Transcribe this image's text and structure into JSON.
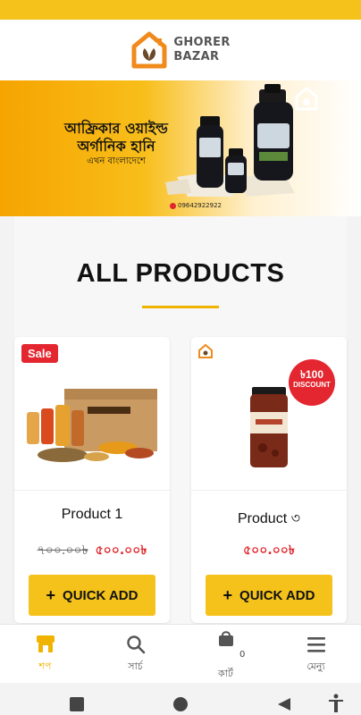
{
  "brand": {
    "line1": "GHORER",
    "line2": "BAZAR"
  },
  "banner": {
    "line1": "আফ্রিকার ওয়াইল্ড",
    "line2": "অর্গানিক হানি",
    "line3": "এখন বাংলাদেশে",
    "phone": "09642922922",
    "jar_label": "HONEY"
  },
  "section": {
    "title": "ALL PRODUCTS"
  },
  "products": [
    {
      "name": "Product 1",
      "old_price": "৭০০.০০৳",
      "price": "৫০০.০০৳",
      "badge": "Sale",
      "button": "QUICK ADD"
    },
    {
      "name": "Product ৩",
      "old_price": "",
      "price": "৫০০.০০৳",
      "badge": "৳100 DISCOUNT",
      "badge_line1": "৳100",
      "badge_line2": "DISCOUNT",
      "button": "QUICK ADD"
    }
  ],
  "bottom_nav": [
    {
      "label": "শপ",
      "icon": "shop-icon",
      "active": true
    },
    {
      "label": "সার্চ",
      "icon": "search-icon",
      "active": false
    },
    {
      "label": "কার্ট",
      "icon": "cart-icon",
      "active": false,
      "count": "0"
    },
    {
      "label": "মেন্যু",
      "icon": "menu-icon",
      "active": false
    }
  ],
  "colors": {
    "accent": "#f4c21a",
    "sale": "#e3262f",
    "price": "#e0262d",
    "brand_orange": "#f08a1c"
  }
}
